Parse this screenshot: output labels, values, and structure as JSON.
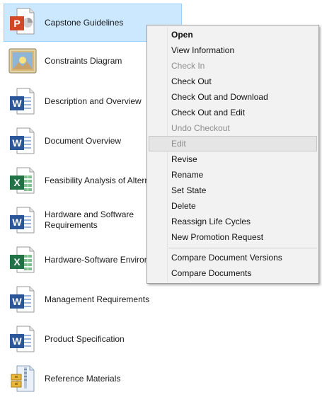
{
  "files": [
    {
      "name": "Capstone Guidelines",
      "icon": "powerpoint-icon"
    },
    {
      "name": "Constraints Diagram",
      "icon": "image-icon"
    },
    {
      "name": "Description and Overview",
      "icon": "word-icon"
    },
    {
      "name": "Document Overview",
      "icon": "word-icon"
    },
    {
      "name": "Feasibility Analysis of Alternatives",
      "icon": "excel-icon"
    },
    {
      "name": "Hardware and Software Requirements",
      "icon": "word-icon"
    },
    {
      "name": "Hardware-Software Environment",
      "icon": "excel-icon"
    },
    {
      "name": "Management Requirements",
      "icon": "word-icon"
    },
    {
      "name": "Product Specification",
      "icon": "word-icon"
    },
    {
      "name": "Reference Materials",
      "icon": "archive-icon"
    }
  ],
  "context_menu": {
    "items": [
      {
        "label": "Open",
        "bold": true
      },
      {
        "label": "View Information"
      },
      {
        "label": "Check In",
        "disabled": true
      },
      {
        "label": "Check Out"
      },
      {
        "label": "Check Out and Download"
      },
      {
        "label": "Check Out and Edit"
      },
      {
        "label": "Undo Checkout",
        "disabled": true
      },
      {
        "label": "Edit",
        "disabled": true,
        "hover": true
      },
      {
        "label": "Revise"
      },
      {
        "label": "Rename"
      },
      {
        "label": "Set State"
      },
      {
        "label": "Delete"
      },
      {
        "label": "Reassign Life Cycles"
      },
      {
        "label": "New Promotion Request"
      },
      {
        "separator": true
      },
      {
        "label": "Compare Document Versions"
      },
      {
        "label": "Compare Documents"
      }
    ]
  },
  "colors": {
    "selection_bg": "#cce8ff",
    "word_blue": "#2b579a",
    "excel_green": "#217346",
    "powerpoint_orange": "#d24726"
  }
}
